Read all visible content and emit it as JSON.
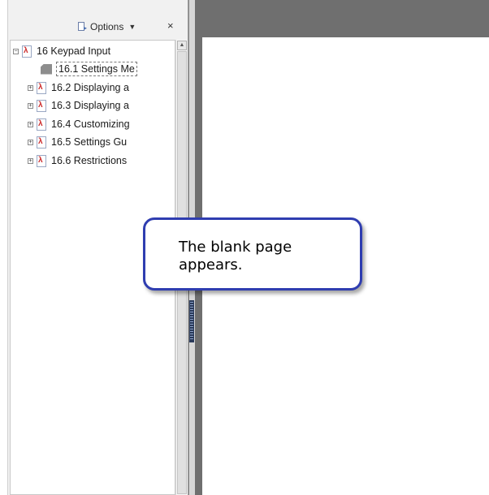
{
  "panel": {
    "options_label": "Options",
    "options_caret": "▼",
    "close_label": "×"
  },
  "tree": {
    "root": {
      "label": "16 Keypad Input",
      "expander": "−"
    },
    "items": [
      {
        "label": "16.1 Settings Me",
        "icon": "gray-page-icon",
        "selected": true
      },
      {
        "label": "16.2 Displaying a",
        "icon": "pdf-bookmark-icon",
        "expander": "+"
      },
      {
        "label": "16.3 Displaying a",
        "icon": "pdf-bookmark-icon",
        "expander": "+"
      },
      {
        "label": "16.4 Customizing",
        "icon": "pdf-bookmark-icon",
        "expander": "+"
      },
      {
        "label": "16.5 Settings Gu",
        "icon": "pdf-bookmark-icon",
        "expander": "+"
      },
      {
        "label": "16.6 Restrictions",
        "icon": "pdf-bookmark-icon",
        "expander": "+"
      }
    ]
  },
  "callout": {
    "line1": "The blank page",
    "line2": "appears."
  },
  "colors": {
    "callout_border": "#2f3db0",
    "doc_background": "#6f6f6f",
    "pdf_icon_red": "#cc2a2a"
  }
}
